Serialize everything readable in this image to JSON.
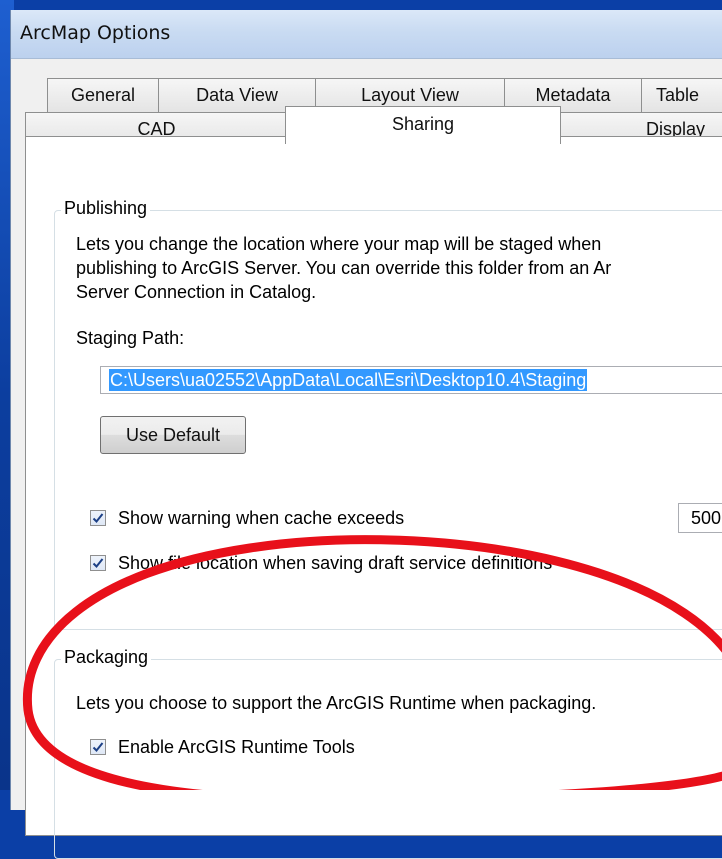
{
  "window": {
    "title": "ArcMap Options"
  },
  "tabs": {
    "row1": [
      "General",
      "Data View",
      "Layout View",
      "Metadata",
      "Table"
    ],
    "row2": [
      "CAD",
      "Sharing",
      "Display"
    ],
    "active": "Sharing"
  },
  "publishing": {
    "group_label": "Publishing",
    "description_lines": [
      "Lets you change the location where your map will be staged when",
      "publishing to ArcGIS Server. You can override this folder from an Ar",
      "Server Connection in Catalog."
    ],
    "staging_label": "Staging Path:",
    "staging_path": "C:\\Users\\ua02552\\AppData\\Local\\Esri\\Desktop10.4\\Staging",
    "use_default_label": "Use Default",
    "show_warning": {
      "label": "Show warning when cache exceeds",
      "checked": true
    },
    "cache_value": "500",
    "show_file_location": {
      "label": "Show file location when saving draft service definitions",
      "checked": true
    }
  },
  "packaging": {
    "group_label": "Packaging",
    "description": "Lets you choose to support the ArcGIS Runtime when packaging.",
    "enable_runtime": {
      "label": "Enable ArcGIS Runtime Tools",
      "checked": true
    }
  },
  "colors": {
    "accent_selection": "#3399ff",
    "annotation_circle": "#e8101a",
    "desktop_blue": "#0b3fa6"
  }
}
